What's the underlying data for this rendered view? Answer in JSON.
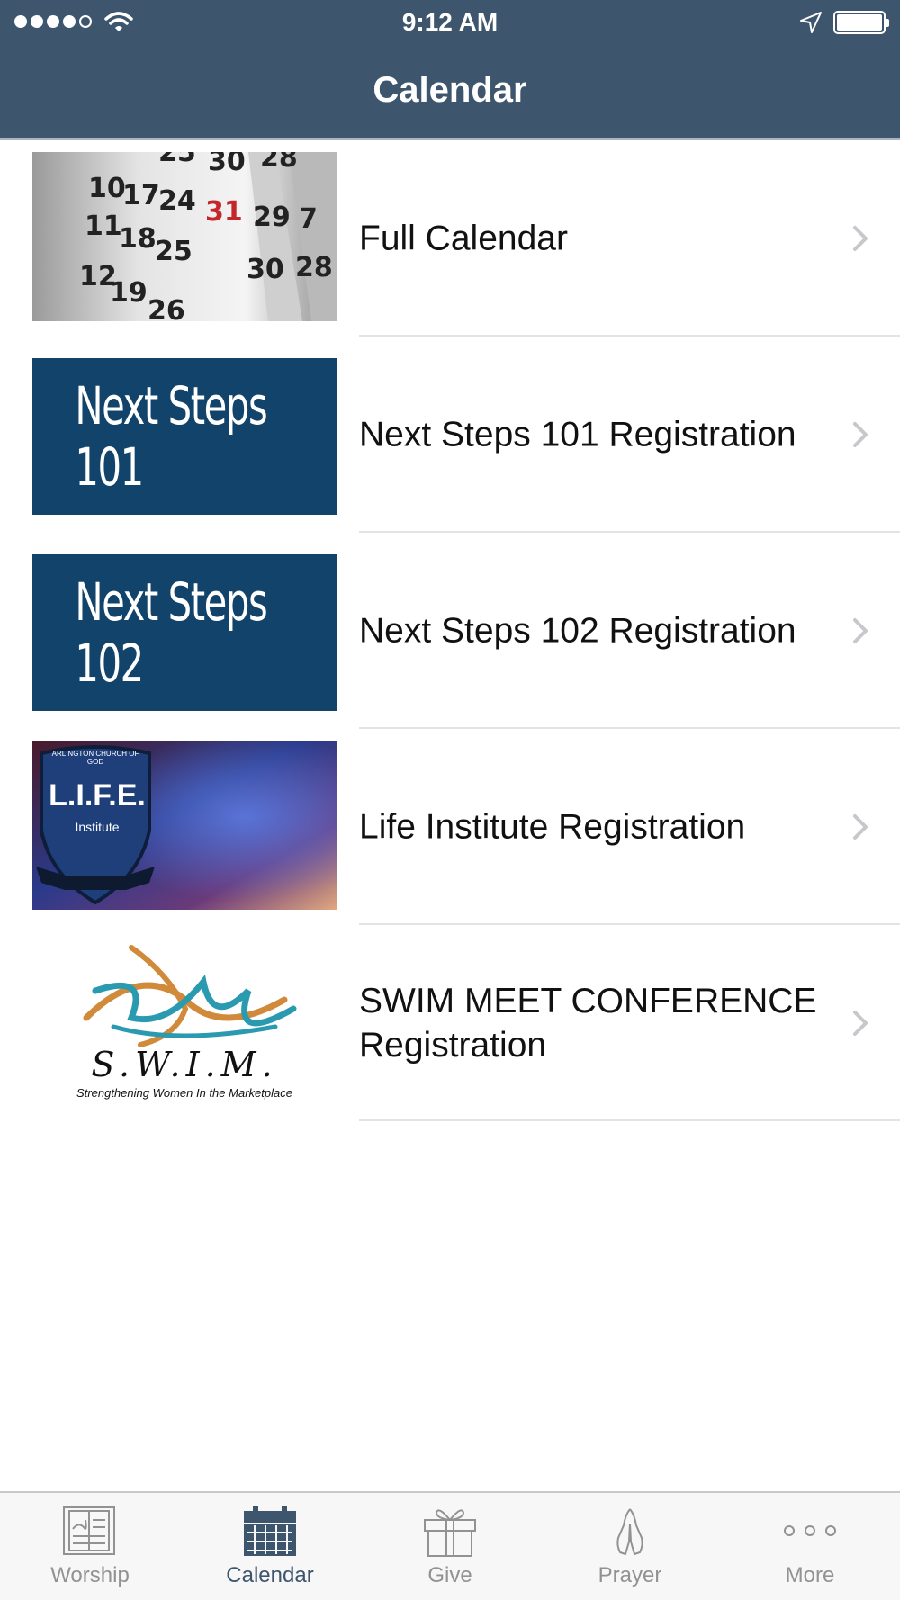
{
  "status_bar": {
    "time": "9:12 AM",
    "signal_icon": "cellular-signal-icon",
    "wifi_icon": "wifi-icon",
    "location_icon": "location-arrow-icon",
    "battery_icon": "battery-icon"
  },
  "header": {
    "title": "Calendar",
    "background_color": "#3d566e"
  },
  "list": {
    "items": [
      {
        "label": "Full Calendar",
        "thumbnail": "calendar-pages-image"
      },
      {
        "label": "Next Steps 101 Registration",
        "thumbnail": "next-steps-101-banner",
        "thumbnail_text": "Next Steps 101"
      },
      {
        "label": "Next Steps 102 Registration",
        "thumbnail": "next-steps-102-banner",
        "thumbnail_text": "Next Steps 102"
      },
      {
        "label": "Life Institute Registration",
        "thumbnail": "life-institute-banner",
        "thumbnail_text": "L.I.F.E.",
        "thumbnail_subtext": "Institute",
        "thumbnail_small_text": "ARLINGTON CHURCH OF GOD"
      },
      {
        "label": "SWIM MEET CONFERENCE Registration",
        "thumbnail": "swim-logo",
        "thumbnail_text": "S.W.I.M.",
        "thumbnail_subtext": "Strengthening Women In the Marketplace"
      }
    ]
  },
  "tabbar": {
    "active_color": "#3d566e",
    "items": [
      {
        "label": "Worship",
        "icon": "open-book-icon"
      },
      {
        "label": "Calendar",
        "icon": "calendar-icon",
        "active": true
      },
      {
        "label": "Give",
        "icon": "gift-icon"
      },
      {
        "label": "Prayer",
        "icon": "praying-hands-icon"
      },
      {
        "label": "More",
        "icon": "more-dots-icon"
      }
    ]
  }
}
